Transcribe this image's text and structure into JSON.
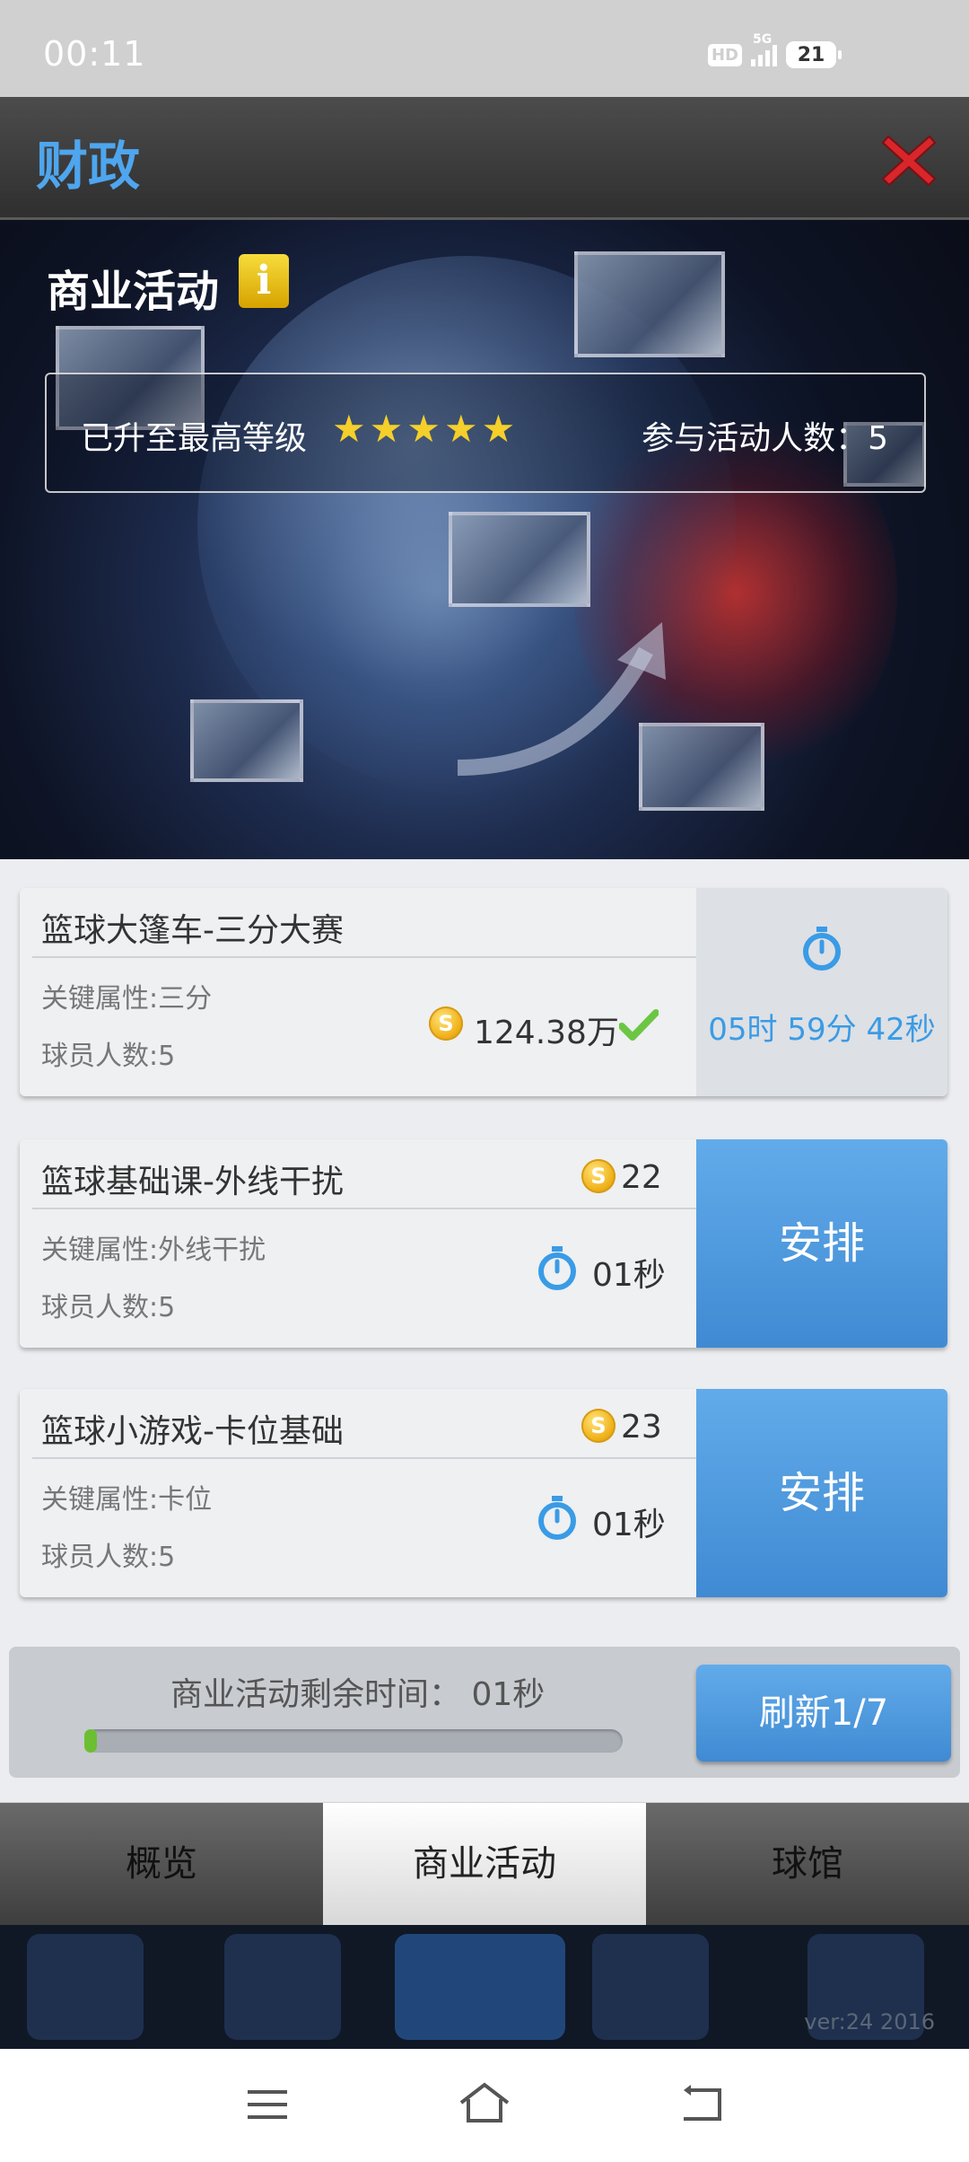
{
  "status_bar": {
    "time": "00:11",
    "hd_label": "HD",
    "network_label": "5G",
    "battery": "21"
  },
  "header": {
    "title": "财政"
  },
  "banner": {
    "section_title": "商业活动",
    "info_icon_glyph": "i",
    "level_text": "已升至最高等级",
    "stars": 5,
    "participants_text": "参与活动人数：5"
  },
  "activities": [
    {
      "name": "篮球大篷车-三分大赛",
      "attr_label": "关键属性:三分",
      "players_label": "球员人数:5",
      "reward": "124.38万",
      "status": "in-progress",
      "countdown": "05时 59分 42秒"
    },
    {
      "name": "篮球基础课-外线干扰",
      "attr_label": "关键属性:外线干扰",
      "players_label": "球员人数:5",
      "cost": "22",
      "duration": "01秒",
      "action_label": "安排"
    },
    {
      "name": "篮球小游戏-卡位基础",
      "attr_label": "关键属性:卡位",
      "players_label": "球员人数:5",
      "cost": "23",
      "duration": "01秒",
      "action_label": "安排"
    }
  ],
  "timer_panel": {
    "remain_text": "商业活动剩余时间： 01秒",
    "progress": 0.02,
    "refresh_label": "刷新1/7"
  },
  "tabs": [
    {
      "label": "概览",
      "active": false
    },
    {
      "label": "商业活动",
      "active": true
    },
    {
      "label": "球馆",
      "active": false
    }
  ],
  "version": "ver:24  2016",
  "colors": {
    "accent_blue": "#4ea6ee",
    "button_blue": "#4a95db",
    "star_yellow": "#f5cf2a",
    "check_green": "#6cc644",
    "close_red": "#d8262b"
  }
}
